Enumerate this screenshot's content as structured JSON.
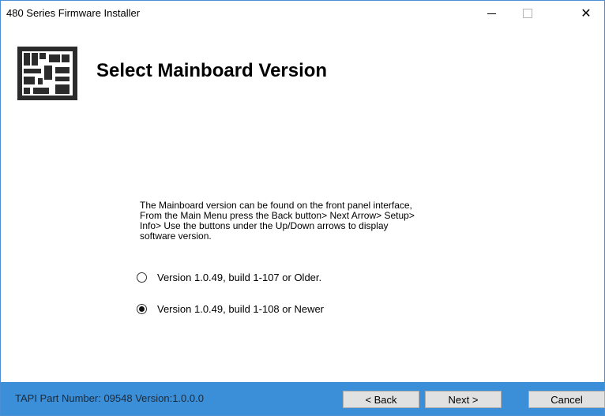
{
  "window": {
    "title": "480 Series Firmware Installer",
    "close_glyph": "✕"
  },
  "header": {
    "logo_icon": "chip-logo-icon",
    "title": "Select Mainboard Version"
  },
  "content": {
    "description_lines": [
      "The Mainboard version can be found on the front panel interface,",
      "From the Main Menu press the Back button> Next Arrow> Setup>",
      "Info> Use the buttons under the Up/Down arrows to display",
      "software version."
    ],
    "options": [
      {
        "label": "Version 1.0.49, build 1-107 or Older.",
        "selected": false
      },
      {
        "label": "Version 1.0.49, build 1-108 or Newer",
        "selected": true
      }
    ]
  },
  "footer": {
    "info_text": "TAPI Part Number: 09548  Version:1.0.0.0",
    "back_label": "< Back",
    "next_label": "Next >",
    "cancel_label": "Cancel"
  },
  "colors": {
    "accent": "#3b8fd9",
    "window_border": "#4a8fd6",
    "button_bg": "#e1e1e1"
  }
}
